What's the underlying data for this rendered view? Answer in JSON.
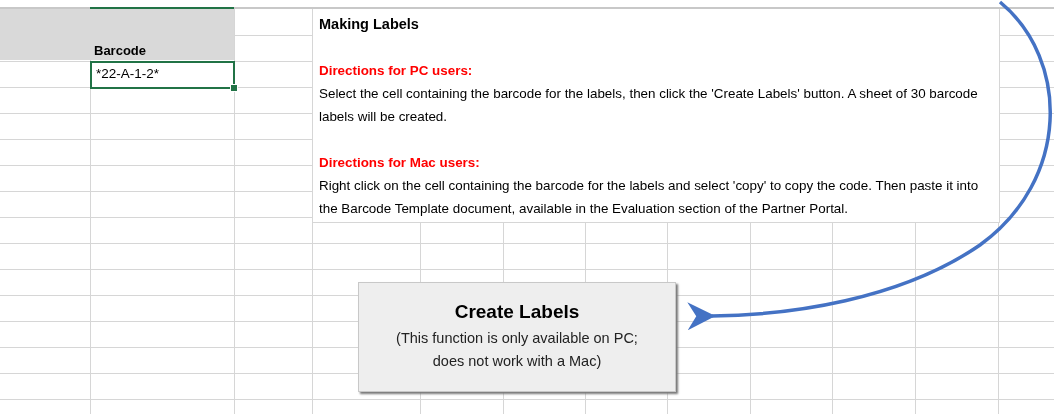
{
  "sheet": {
    "header_cell": "Barcode",
    "barcode_cell": {
      "value": "*22-A-1-2*",
      "selected": true
    }
  },
  "note": {
    "title": "Making Labels",
    "sections": [
      {
        "heading": "Directions for PC users:",
        "body": "Select the cell containing the barcode for the labels, then click the 'Create Labels' button. A sheet of 30 barcode labels will be created."
      },
      {
        "heading": "Directions for Mac users:",
        "body": "Right click on the cell containing the barcode for the labels and select 'copy' to copy the code. Then paste it into the Barcode Template document, available in the Evaluation section of the Partner Portal."
      }
    ]
  },
  "button": {
    "title": "Create Labels",
    "lines": [
      "(This function is only available on PC;",
      "does not work with a Mac)"
    ]
  }
}
